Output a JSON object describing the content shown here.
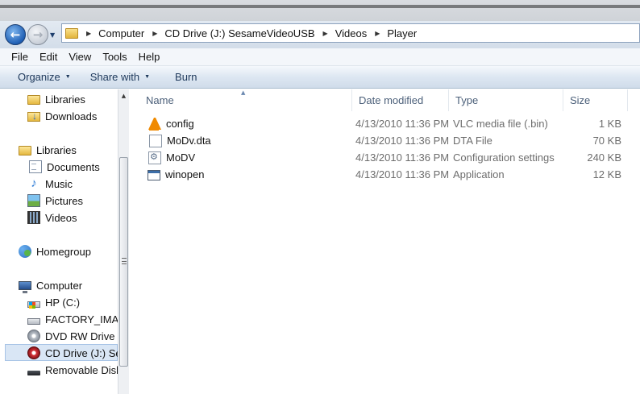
{
  "address_bar": {
    "breadcrumbs": [
      "Computer",
      "CD Drive (J:) SesameVideoUSB",
      "Videos",
      "Player"
    ]
  },
  "menu": [
    "File",
    "Edit",
    "View",
    "Tools",
    "Help"
  ],
  "toolbar": {
    "organize": "Organize",
    "share_with": "Share with",
    "burn": "Burn"
  },
  "nav_pane": {
    "items": [
      {
        "label": "Libraries",
        "icon": "libraries-folder-icon"
      },
      {
        "label": "Downloads",
        "icon": "downloads-icon"
      },
      {
        "label": "Libraries",
        "icon": "libraries-icon"
      },
      {
        "label": "Documents",
        "icon": "documents-icon"
      },
      {
        "label": "Music",
        "icon": "music-icon"
      },
      {
        "label": "Pictures",
        "icon": "pictures-icon"
      },
      {
        "label": "Videos",
        "icon": "videos-icon"
      },
      {
        "label": "Homegroup",
        "icon": "homegroup-icon"
      },
      {
        "label": "Computer",
        "icon": "computer-icon"
      },
      {
        "label": "HP (C:)",
        "icon": "hp-drive-icon"
      },
      {
        "label": "FACTORY_IMAGE",
        "icon": "hard-drive-icon"
      },
      {
        "label": "DVD RW Drive (E:)",
        "icon": "dvd-drive-icon"
      },
      {
        "label": "CD Drive (J:) SesameVideoUSB",
        "icon": "cd-drive-icon"
      },
      {
        "label": "Removable Disk (",
        "icon": "removable-disk-icon"
      }
    ]
  },
  "file_list": {
    "columns": [
      "Name",
      "Date modified",
      "Type",
      "Size"
    ],
    "rows": [
      {
        "name": "config",
        "date": "4/13/2010 11:36 PM",
        "type": "VLC media file (.bin)",
        "size": "1 KB",
        "icon": "vlc-icon"
      },
      {
        "name": "MoDv.dta",
        "date": "4/13/2010 11:36 PM",
        "type": "DTA File",
        "size": "70 KB",
        "icon": "file-icon"
      },
      {
        "name": "MoDV",
        "date": "4/13/2010 11:36 PM",
        "type": "Configuration settings",
        "size": "240 KB",
        "icon": "config-settings-icon"
      },
      {
        "name": "winopen",
        "date": "4/13/2010 11:36 PM",
        "type": "Application",
        "size": "12 KB",
        "icon": "application-icon"
      }
    ]
  },
  "colors": {
    "command_text": "#1e395b",
    "header_text": "#4c607a",
    "selection": "#d9e6f5"
  }
}
